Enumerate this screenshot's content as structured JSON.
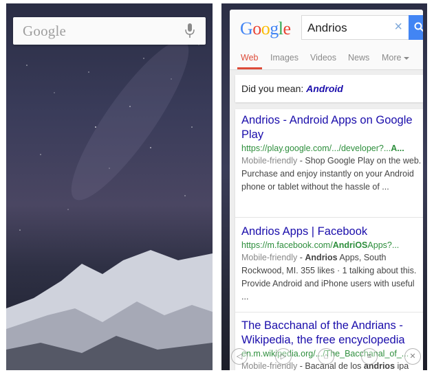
{
  "home": {
    "search_logo": "Google",
    "mic_icon": "microphone-icon"
  },
  "search": {
    "logo_letters": [
      {
        "ch": "G",
        "color": "#4285f4"
      },
      {
        "ch": "o",
        "color": "#ea4335"
      },
      {
        "ch": "o",
        "color": "#fbbc05"
      },
      {
        "ch": "g",
        "color": "#4285f4"
      },
      {
        "ch": "l",
        "color": "#34a853"
      },
      {
        "ch": "e",
        "color": "#ea4335"
      }
    ],
    "query": "Andrios",
    "clear_icon": "×",
    "tabs": [
      {
        "label": "Web",
        "active": true
      },
      {
        "label": "Images"
      },
      {
        "label": "Videos"
      },
      {
        "label": "News"
      },
      {
        "label": "More"
      }
    ],
    "did_you_mean_prefix": "Did you mean:",
    "did_you_mean_term": "Android",
    "results": [
      {
        "title": "Andrios - Android Apps on Google Play",
        "url_prefix": "https://play.google.com/.../developer?...",
        "url_bold": "A...",
        "mobile_friendly": "Mobile-friendly",
        "snippet": " - Shop Google Play on the web. Purchase and enjoy instantly on your Android phone or tablet without the hassle of ..."
      },
      {
        "title": "Andrios Apps | Facebook",
        "url_prefix": "https://m.facebook.com/",
        "url_bold": "AndriOS",
        "url_suffix": "Apps?...",
        "mobile_friendly": "Mobile-friendly",
        "snippet_bold": "Andrios",
        "snippet": " Apps, South Rockwood, MI. 355 likes · 1 talking about this. Provide Android and iPhone users with useful ..."
      },
      {
        "title": "The Bacchanal of the Andrians - Wikipedia, the free encyclopedia",
        "url": "en.m.wikipedia.org/.../The_Bacchanal_of_...",
        "mobile_friendly": "Mobile-friendly",
        "snippet_prefix": " - Bacanal de los ",
        "snippet_bold": "andrios",
        "snippet_suffix": " ipa"
      }
    ],
    "colors": {
      "link": "#1a0dab",
      "url": "#2d8e3c",
      "tab_active": "#dd4b39",
      "search_button": "#4285f4"
    }
  }
}
